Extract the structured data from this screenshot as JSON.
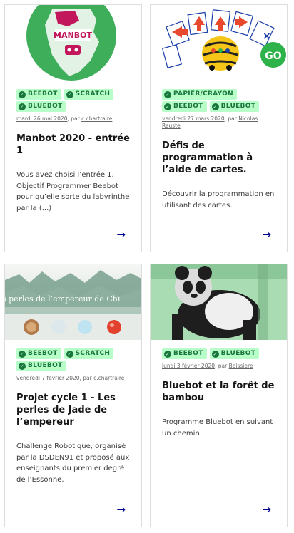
{
  "cards": [
    {
      "tags": [
        "BEEBOT",
        "SCRATCH",
        "BLUEBOT"
      ],
      "date": "mardi 26 mai 2020",
      "by": ", par",
      "author": "c.chartraire",
      "title": "Manbot 2020 - entrée 1",
      "desc": "Vous avez choisi l’entrée 1. Objectif Programmer Beebot pour qu’elle sorte du labyrinthe par la (...)",
      "image_label": "MANBOT"
    },
    {
      "tags": [
        "PAPIER/CRAYON",
        "BEEBOT",
        "BLUEBOT"
      ],
      "date": "vendredi 27 mars 2020",
      "by": ", par",
      "author": "Nicolas Reuste",
      "title": "Défis de programmation à l’aide de cartes.",
      "desc": "Découvrir la programmation en utilisant des cartes.",
      "image_label": "GO"
    },
    {
      "tags": [
        "BEEBOT",
        "SCRATCH",
        "BLUEBOT"
      ],
      "date": "vendredi 7 février 2020",
      "by": ", par",
      "author": "c.chartraire",
      "title": "Projet cycle 1 - Les perles de Jade de l’empereur",
      "desc": "Challenge Robotique, organisé par la DSDEN91 et proposé aux enseignants du premier degré de l’Essonne.",
      "image_label": "s perles de l’empereur de Chi"
    },
    {
      "tags": [
        "BEEBOT",
        "BLUEBOT"
      ],
      "date": "lundi 3 février 2020",
      "by": ", par",
      "author": "Boissiere",
      "title": "Bluebot et la forêt de bambou",
      "desc": "Programme Bluebot en suivant un chemin",
      "image_label": ""
    }
  ],
  "arrow_icon": "arrow-right-icon",
  "colors": {
    "tag_bg": "#b8fec9",
    "tag_fg": "#18753c",
    "arrow": "#000091",
    "border": "#dddddd"
  }
}
